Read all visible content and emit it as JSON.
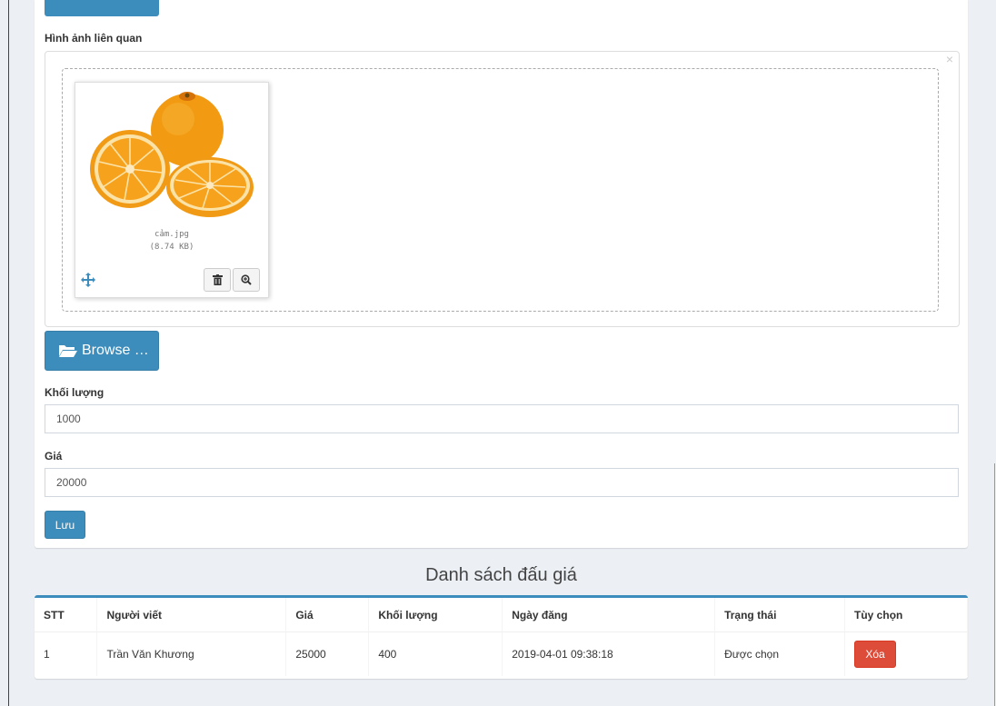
{
  "images_section": {
    "label": "Hình ảnh liên quan",
    "close_glyph": "×",
    "file": {
      "name": "cảm.jpg",
      "size": "(8.74 KB)"
    }
  },
  "browse_button": {
    "label": "Browse …",
    "icon": "folder-open-icon"
  },
  "weight": {
    "label": "Khối lượng",
    "value": "1000"
  },
  "price": {
    "label": "Giá",
    "value": "20000"
  },
  "save_button": {
    "label": "Lưu"
  },
  "auction_list": {
    "title": "Danh sách đấu giá",
    "columns": [
      "STT",
      "Người viết",
      "Giá",
      "Khối lượng",
      "Ngày đăng",
      "Trạng thái",
      "Tùy chọn"
    ],
    "rows": [
      {
        "stt": "1",
        "author": "Trần Văn Khương",
        "price": "25000",
        "weight": "400",
        "date": "2019-04-01 09:38:18",
        "status": "Được chọn",
        "action": "Xóa"
      }
    ]
  },
  "colors": {
    "primary": "#3c8dbc",
    "danger": "#dd4b39",
    "background": "#ecf0f5"
  }
}
